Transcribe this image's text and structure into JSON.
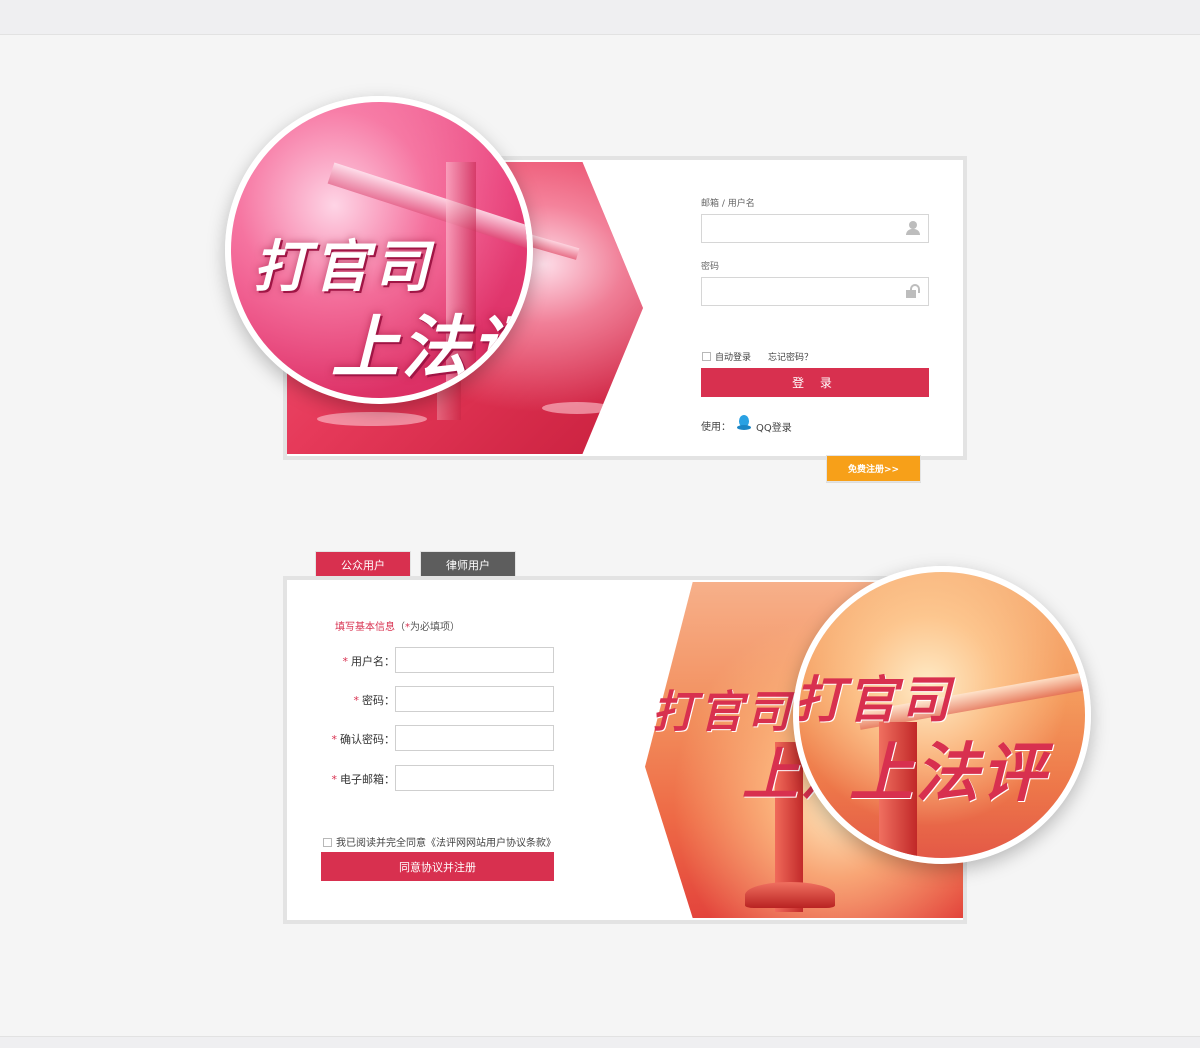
{
  "banner": {
    "line1": "打官司",
    "line2": "上法评"
  },
  "login": {
    "username_label": "邮箱 / 用户名",
    "password_label": "密码",
    "auto_login": "自动登录",
    "forgot_password": "忘记密码？",
    "login_button": "登 录",
    "use_label": "使用：",
    "qq_login": "QQ登录",
    "register_link": "免费注册>>"
  },
  "register": {
    "tabs": [
      {
        "label": "公众用户"
      },
      {
        "label": "律师用户"
      }
    ],
    "title": "填写基本信息",
    "required_note_open": "（",
    "required_star": "*",
    "required_note": "为必填项）",
    "fields": [
      {
        "label": "用户名："
      },
      {
        "label": "密码："
      },
      {
        "label": "确认密码："
      },
      {
        "label": "电子邮箱："
      }
    ],
    "agreement": "我已阅读并完全同意《法评网网站用户协议条款》",
    "submit_button": "同意协议并注册"
  }
}
